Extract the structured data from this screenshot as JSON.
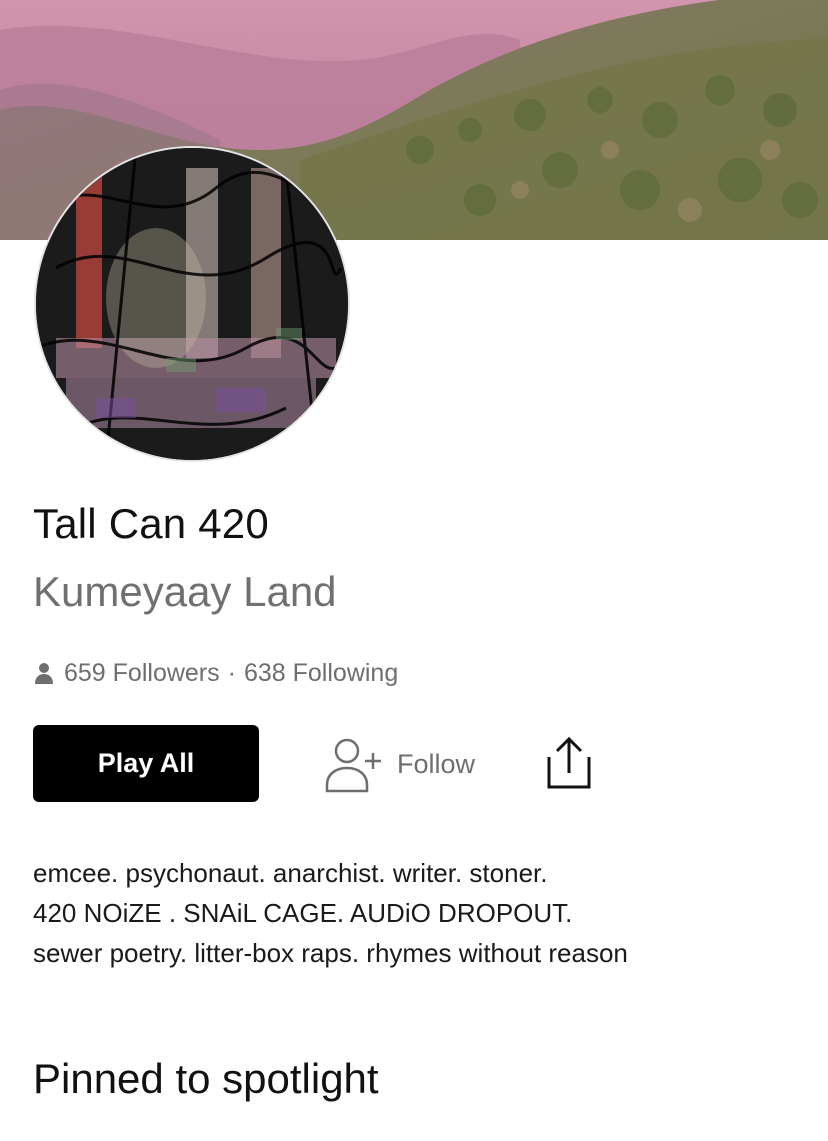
{
  "profile": {
    "name": "Tall Can 420",
    "location": "Kumeyaay Land",
    "followers": "659 Followers",
    "separator": "·",
    "following": "638 Following"
  },
  "actions": {
    "play_all_label": "Play All",
    "follow_label": "Follow"
  },
  "bio": {
    "lines": [
      "emcee. psychonaut. anarchist. writer. stoner.",
      "420 NOiZE . SNAiL CAGE. AUDiO DROPOUT.",
      "sewer poetry. litter-box raps. rhymes without reason"
    ]
  },
  "sections": {
    "pinned_title": "Pinned to spotlight"
  },
  "icons": {
    "followers": "person-icon",
    "follow": "add-user-icon",
    "share": "share-icon"
  },
  "colors": {
    "primary_button": "#000000",
    "muted_text": "#707070",
    "cover_pink": "#c98aa6",
    "cover_green": "#6f7a4a"
  }
}
